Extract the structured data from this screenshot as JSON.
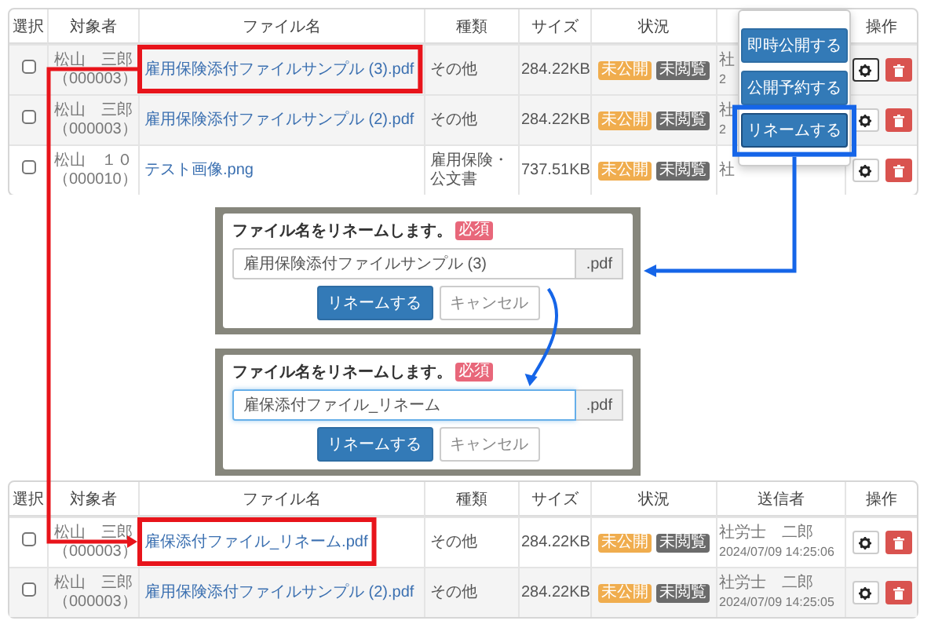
{
  "before_table": {
    "columns": [
      {
        "label": "選択",
        "kind": "select"
      },
      {
        "label": "対象者",
        "kind": "person"
      },
      {
        "label": "ファイル名",
        "kind": "file"
      },
      {
        "label": "種類",
        "kind": "type"
      },
      {
        "label": "サイズ",
        "kind": "size"
      },
      {
        "label": "状況",
        "kind": "status"
      },
      {
        "kind": "sender"
      },
      {
        "label": "操作",
        "kind": "actions"
      }
    ],
    "rows": [
      {
        "checked": false,
        "highlighted": true,
        "person": [
          "松山　三郎",
          "（000003）"
        ],
        "file": "雇用保険添付ファイルサンプル (3).pdf",
        "marked": true,
        "type": "その他",
        "size": "284.22KB",
        "statuses": [
          {
            "label": "未公開",
            "color": "#f0ad4e"
          },
          {
            "label": "未閲覧",
            "color": "#6b6b6b"
          }
        ],
        "sender": [
          "社",
          "2"
        ],
        "pressed": true
      },
      {
        "checked": false,
        "highlighted": true,
        "person": [
          "松山　三郎",
          "（000003）"
        ],
        "file": "雇用保険添付ファイルサンプル (2).pdf",
        "marked": false,
        "type": "その他",
        "size": "284.22KB",
        "statuses": [
          {
            "label": "未公開",
            "color": "#f0ad4e"
          },
          {
            "label": "未閲覧",
            "color": "#6b6b6b"
          }
        ],
        "sender": [
          "社",
          "2"
        ],
        "pressed": false
      },
      {
        "checked": false,
        "highlighted": false,
        "person": [
          "松山　１０",
          "（000010）"
        ],
        "file": "テスト画像.png",
        "marked": false,
        "type": "雇用保険・公文書",
        "size": "737.51KB",
        "statuses": [
          {
            "label": "未公開",
            "color": "#f0ad4e"
          },
          {
            "label": "未閲覧",
            "color": "#6b6b6b"
          }
        ],
        "sender": [
          "社"
        ],
        "pressed": false
      }
    ],
    "action_menu": {
      "items": [
        {
          "label": "即時公開する",
          "marked": false
        },
        {
          "label": "公開予約する",
          "marked": false
        },
        {
          "label": "リネームする",
          "marked": true
        }
      ]
    }
  },
  "rename_dialogs": [
    {
      "title": "ファイル名をリネームします。",
      "badge": "必須",
      "value": "雇用保険添付ファイルサンプル (3)",
      "focused": false,
      "suffix": ".pdf",
      "buttons": [
        "リネームする",
        "キャンセル"
      ]
    },
    {
      "title": "ファイル名をリネームします。",
      "badge": "必須",
      "value": "雇保添付ファイル_リネーム",
      "focused": true,
      "suffix": ".pdf",
      "buttons": [
        "リネームする",
        "キャンセル"
      ]
    }
  ],
  "after_table": {
    "columns": [
      {
        "label": "選択",
        "kind": "select"
      },
      {
        "label": "対象者",
        "kind": "person"
      },
      {
        "label": "ファイル名",
        "kind": "file"
      },
      {
        "label": "種類",
        "kind": "type"
      },
      {
        "label": "サイズ",
        "kind": "size"
      },
      {
        "label": "状況",
        "kind": "status"
      },
      {
        "label": "送信者",
        "kind": "sender"
      },
      {
        "label": "操作",
        "kind": "actions"
      }
    ],
    "rows": [
      {
        "checked": false,
        "highlighted": false,
        "person": [
          "松山　三郎",
          "（000003）"
        ],
        "file": "雇保添付ファイル_リネーム.pdf",
        "marked": true,
        "type": "その他",
        "size": "284.22KB",
        "statuses": [
          {
            "label": "未公開",
            "color": "#f0ad4e"
          },
          {
            "label": "未閲覧",
            "color": "#6b6b6b"
          }
        ],
        "sender": [
          "社労士　二郎",
          "2024/07/09 14:25:06"
        ],
        "pressed": false
      },
      {
        "checked": false,
        "highlighted": true,
        "person": [
          "松山　三郎",
          "（000003）"
        ],
        "file": "雇用保険添付ファイルサンプル (2).pdf",
        "marked": false,
        "type": "その他",
        "size": "284.22KB",
        "statuses": [
          {
            "label": "未公開",
            "color": "#f0ad4e"
          },
          {
            "label": "未閲覧",
            "color": "#6b6b6b"
          }
        ],
        "sender": [
          "社労士　二郎",
          "2024/07/09 14:25:05"
        ],
        "pressed": false
      }
    ]
  }
}
